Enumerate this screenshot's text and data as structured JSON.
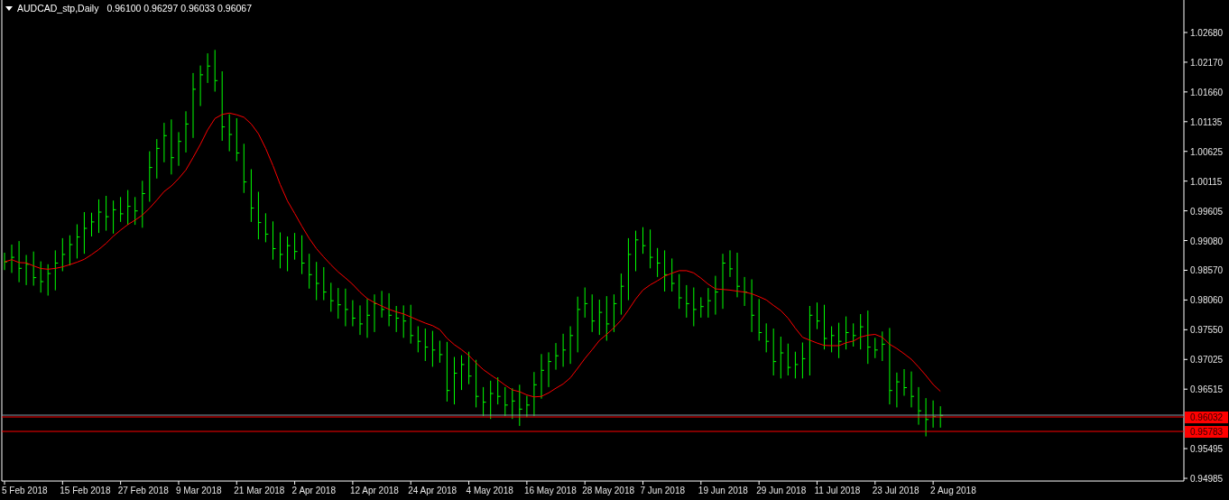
{
  "header": {
    "symbol": "AUDCAD_stp,Daily",
    "quote": "0.96100 0.96297 0.96033 0.96067"
  },
  "price_axis": {
    "labels": [
      "1.02680",
      "1.02170",
      "1.01660",
      "1.01135",
      "1.00625",
      "1.00115",
      "0.99605",
      "0.99080",
      "0.98570",
      "0.98060",
      "0.97550",
      "0.97025",
      "0.96515",
      "0.95495",
      "0.94985"
    ]
  },
  "price_tags": [
    {
      "label": "0.96032",
      "color": "#ff0000"
    },
    {
      "label": "0.95783",
      "color": "#ff0000"
    }
  ],
  "date_axis": {
    "labels": [
      "5 Feb 2018",
      "15 Feb 2018",
      "27 Feb 2018",
      "9 Mar 2018",
      "21 Mar 2018",
      "2 Apr 2018",
      "12 Apr 2018",
      "24 Apr 2018",
      "4 May 2018",
      "16 May 2018",
      "28 May 2018",
      "7 Jun 2018",
      "19 Jun 2018",
      "29 Jun 2018",
      "11 Jul 2018",
      "23 Jul 2018",
      "2 Aug 2018"
    ]
  }
}
